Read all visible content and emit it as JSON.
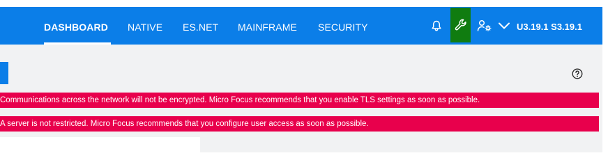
{
  "header": {
    "nav": [
      {
        "label": "DASHBOARD",
        "active": true
      },
      {
        "label": "NATIVE",
        "active": false
      },
      {
        "label": "ES.NET",
        "active": false
      },
      {
        "label": "MAINFRAME",
        "active": false
      },
      {
        "label": "SECURITY",
        "active": false
      }
    ],
    "icons": {
      "notifications": "bell-icon",
      "tools": "wrench-icon",
      "user_settings": "user-gear-icon",
      "expand": "chevron-down-icon"
    },
    "version": "U3.19.1 S3.19.1",
    "colors": {
      "header_bg": "#0b7ee8",
      "tools_highlight": "#107c10"
    }
  },
  "content": {
    "help_icon": "help-circle-icon",
    "banners": [
      {
        "text": "Communications across the network will not be encrypted. Micro Focus recommends that you enable TLS settings as soon as possible."
      },
      {
        "text": "A server is not restricted. Micro Focus recommends that you configure user access as soon as possible."
      }
    ],
    "colors": {
      "banner_bg": "#e8004c",
      "page_bg": "#f1f2f3"
    }
  }
}
